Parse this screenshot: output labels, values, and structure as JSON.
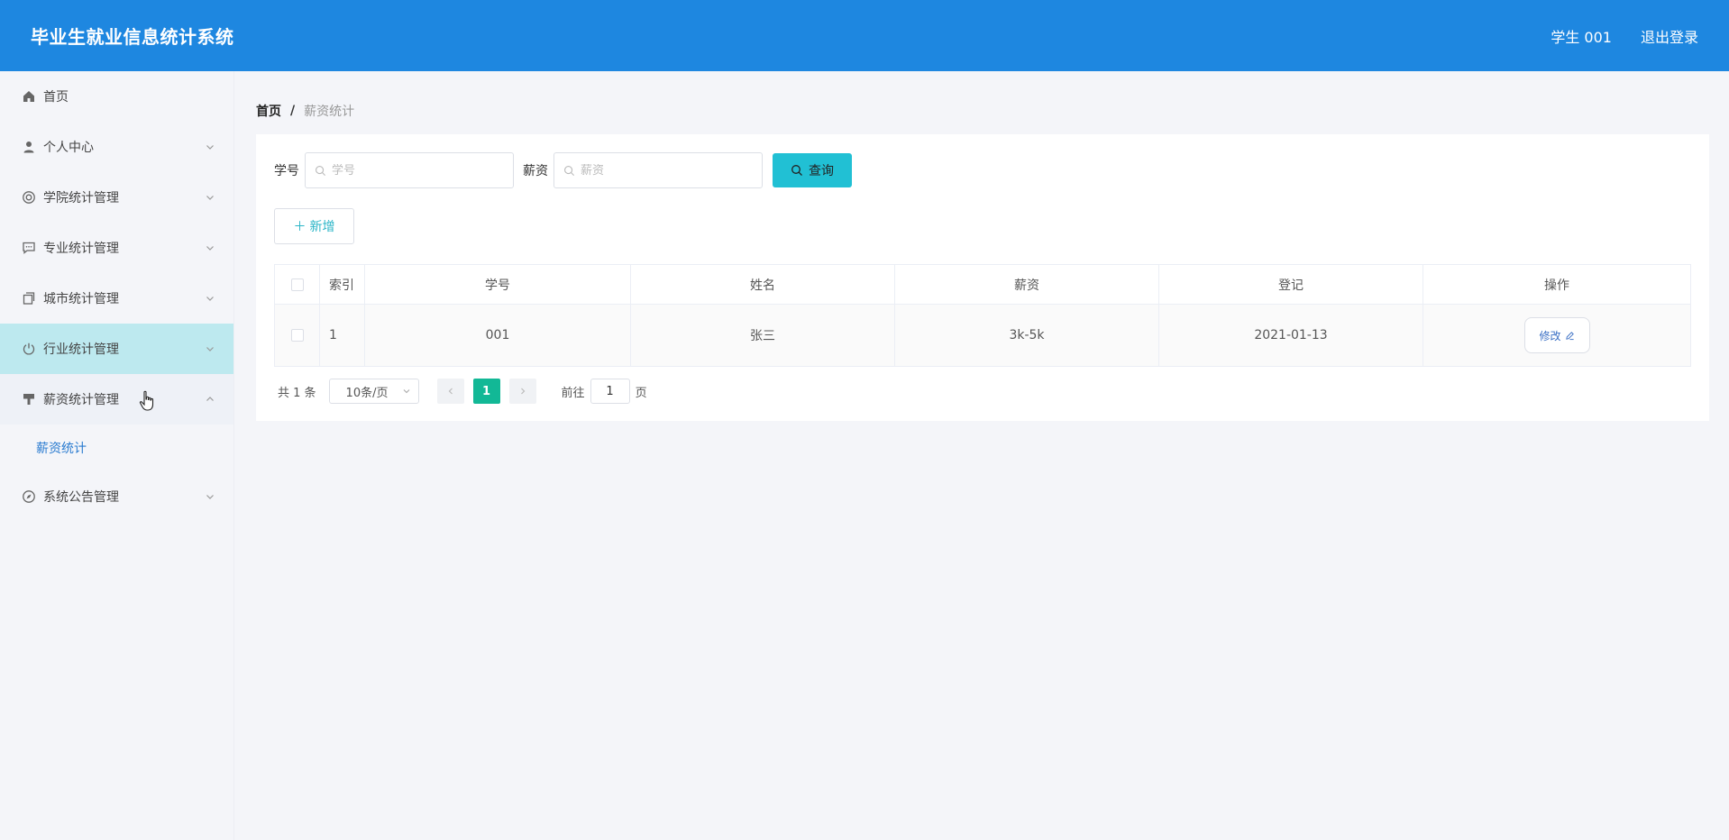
{
  "header": {
    "title": "毕业生就业信息统计系统",
    "user": "学生 001",
    "logout": "退出登录"
  },
  "sidebar": {
    "items": [
      {
        "label": "首页",
        "icon": "home-icon"
      },
      {
        "label": "个人中心",
        "icon": "user-icon"
      },
      {
        "label": "学院统计管理",
        "icon": "lifebuoy-icon"
      },
      {
        "label": "专业统计管理",
        "icon": "chat-icon"
      },
      {
        "label": "城市统计管理",
        "icon": "copy-icon"
      },
      {
        "label": "行业统计管理",
        "icon": "power-icon"
      },
      {
        "label": "薪资统计管理",
        "icon": "brush-icon"
      },
      {
        "label": "系统公告管理",
        "icon": "compass-icon"
      }
    ],
    "subitem": "薪资统计"
  },
  "breadcrumb": {
    "home": "首页",
    "separator": "/",
    "current": "薪资统计"
  },
  "search": {
    "id_label": "学号",
    "id_placeholder": "学号",
    "salary_label": "薪资",
    "salary_placeholder": "薪资",
    "query_label": "查询"
  },
  "toolbar": {
    "add_label": "新增"
  },
  "table": {
    "headers": [
      "索引",
      "学号",
      "姓名",
      "薪资",
      "登记",
      "操作"
    ],
    "rows": [
      {
        "index": "1",
        "student_id": "001",
        "name": "张三",
        "salary": "3k-5k",
        "date": "2021-01-13",
        "action": "修改"
      }
    ]
  },
  "pagination": {
    "total": "共 1 条",
    "page_size": "10条/页",
    "current_page": "1",
    "goto_prefix": "前往",
    "goto_value": "1",
    "goto_suffix": "页"
  },
  "colors": {
    "header_bg": "#1e87e0",
    "highlight_menu": "#bde9ef",
    "query_button": "#21c0d4",
    "active_page": "#12b896",
    "link": "#2a7bd0"
  }
}
